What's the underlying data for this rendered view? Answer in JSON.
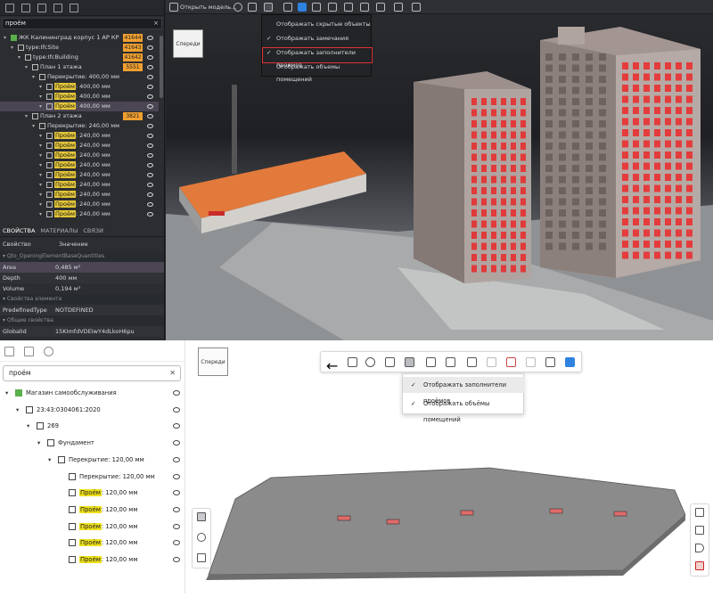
{
  "top": {
    "search_value": "проём",
    "clear_label": "×",
    "tree": [
      {
        "name": "ЖК Калининград корпус 1 АР КР",
        "badge": "41644",
        "indent": 0
      },
      {
        "name": "type:IfcSite",
        "badge": "41643",
        "indent": 1
      },
      {
        "name": "type:IfcBuilding",
        "badge": "41642",
        "indent": 2
      },
      {
        "name": "План 1 этажа",
        "badge": "5551",
        "indent": 3
      },
      {
        "name": "Перекрытие: 400,00 мм",
        "indent": 4
      },
      {
        "pre": "Проём",
        "name": ": 400,00 мм",
        "indent": 5
      },
      {
        "pre": "Проём",
        "name": ": 400,00 мм",
        "indent": 5
      },
      {
        "pre": "Проём",
        "name": ": 400,00 мм",
        "indent": 5,
        "selected": true
      },
      {
        "name": "План 2 этажа",
        "badge": "3821",
        "indent": 3
      },
      {
        "name": "Перекрытие: 240,00 мм",
        "indent": 4
      },
      {
        "pre": "Проём",
        "name": ": 240,00 мм",
        "indent": 5
      },
      {
        "pre": "Проём",
        "name": ": 240,00 мм",
        "indent": 5
      },
      {
        "pre": "Проём",
        "name": ": 240,00 мм",
        "indent": 5
      },
      {
        "pre": "Проём",
        "name": ": 240,00 мм",
        "indent": 5
      },
      {
        "pre": "Проём",
        "name": ": 240,00 мм",
        "indent": 5
      },
      {
        "pre": "Проём",
        "name": ": 240,00 мм",
        "indent": 5
      },
      {
        "pre": "Проём",
        "name": ": 240,00 мм",
        "indent": 5
      },
      {
        "pre": "Проём",
        "name": ": 240,00 мм",
        "indent": 5
      },
      {
        "pre": "Проём",
        "name": ": 240,00 мм",
        "indent": 5
      }
    ],
    "tabs": [
      "СВОЙСТВА",
      "МАТЕРИАЛЫ",
      "СВЯЗИ"
    ],
    "props_header": {
      "k": "Свойство",
      "v": "Значение"
    },
    "props": [
      {
        "type": "sec",
        "k": "▾ Qto_OpeningElementBaseQuantities"
      },
      {
        "type": "hi",
        "k": "Area",
        "v": "0,485 м²"
      },
      {
        "type": "alt",
        "k": "Depth",
        "v": "400 мм"
      },
      {
        "type": "",
        "k": "Volume",
        "v": "0,194 м³"
      },
      {
        "type": "sec",
        "k": "▾ Свойства элемента"
      },
      {
        "type": "alt",
        "k": "PredefinedType",
        "v": "NOTDEFINED"
      },
      {
        "type": "sec",
        "k": "▾ Общие свойства"
      },
      {
        "type": "alt",
        "k": "GlobalId",
        "v": "15KImfdVDEIwY4dLkoH6pu"
      }
    ],
    "open_model_label": "Открыть модель...",
    "menu": [
      {
        "label": "Отображать скрытые объекты",
        "checked": false
      },
      {
        "label": "Отображать замечания",
        "checked": true
      },
      {
        "label": "Отображать заполнители проемов",
        "checked": true
      },
      {
        "label": "Отображать объемы помещений",
        "checked": false
      }
    ],
    "cube_label": "Спереди"
  },
  "bottom": {
    "search_value": "проём",
    "clear_label": "✕",
    "tree": [
      {
        "name": "Магазин самообслуживания",
        "indent": 0,
        "icon": "grn"
      },
      {
        "name": "23:43:0304061:2020",
        "indent": 1
      },
      {
        "name": "269",
        "indent": 2
      },
      {
        "name": "Фундамент",
        "indent": 3
      },
      {
        "name": "Перекрытие: 120,00 мм",
        "indent": 4
      },
      {
        "name": "Перекрытие: 120,00 мм",
        "indent": 5
      },
      {
        "pre": "Проём",
        "name": ": 120,00 мм",
        "indent": 5
      },
      {
        "pre": "Проём",
        "name": ": 120,00 мм",
        "indent": 5
      },
      {
        "pre": "Проём",
        "name": ": 120,00 мм",
        "indent": 5
      },
      {
        "pre": "Проём",
        "name": ": 120,00 мм",
        "indent": 5
      },
      {
        "pre": "Проём",
        "name": ": 120,00 мм",
        "indent": 5
      }
    ],
    "menu": [
      {
        "label": "Отображать заполнители проёмов",
        "checked": true
      },
      {
        "label": "Отображать объёмы помещений",
        "checked": true
      }
    ],
    "cube_label": "Спереди"
  }
}
